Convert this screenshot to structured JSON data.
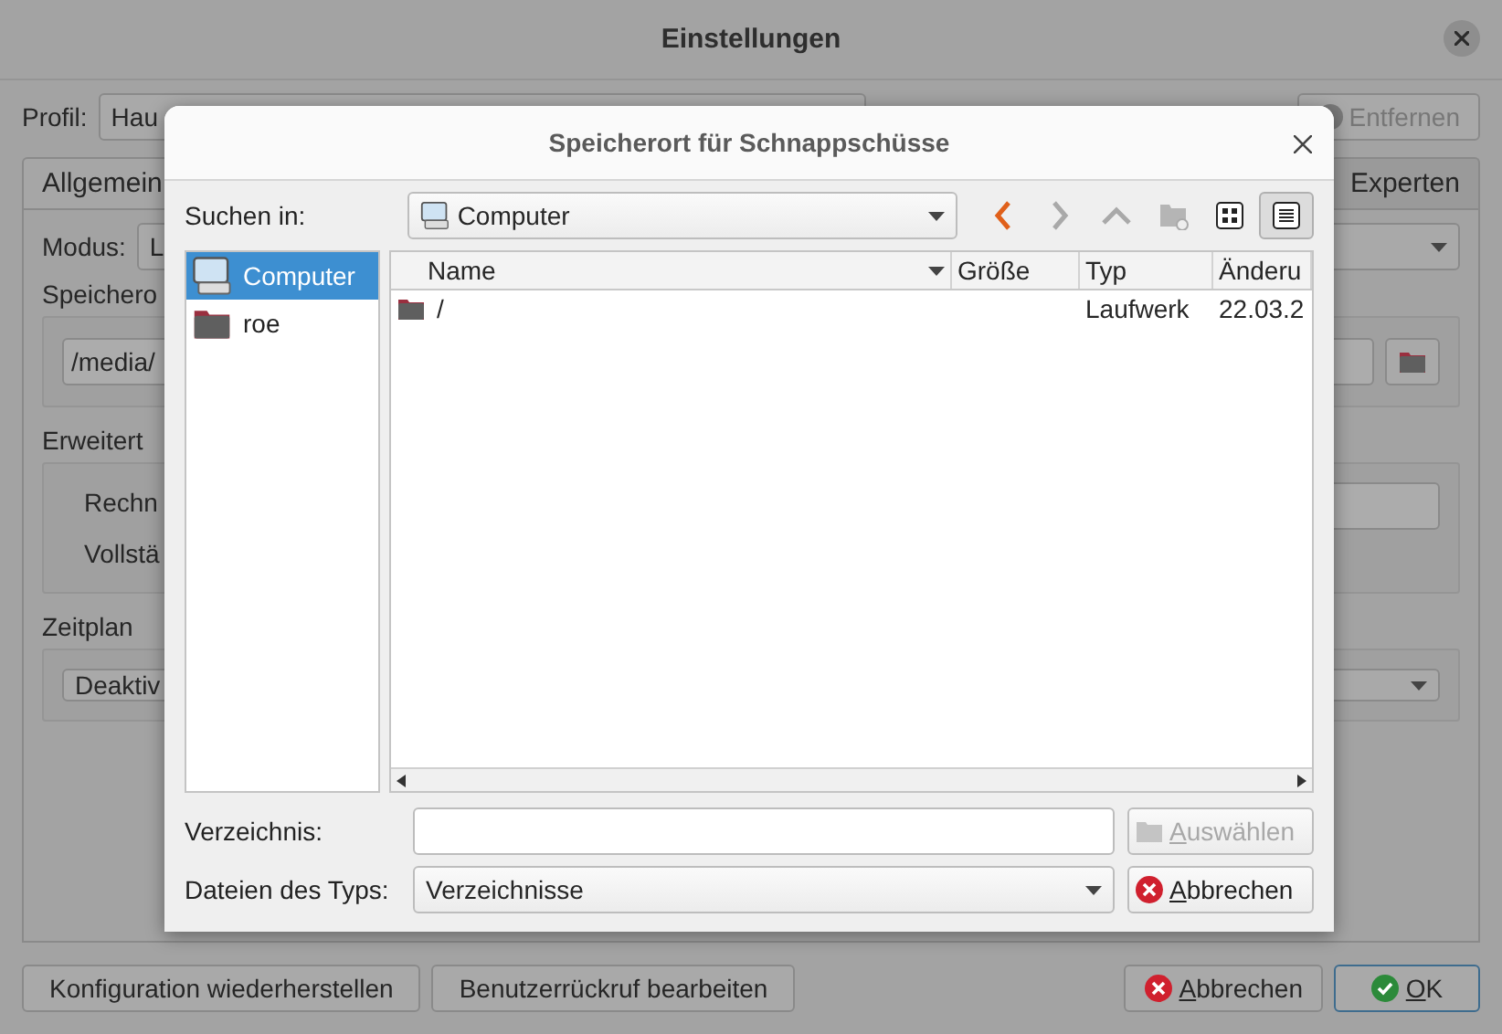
{
  "window": {
    "title": "Einstellungen"
  },
  "profile": {
    "label": "Profil:",
    "value": "Hau",
    "remove_button": {
      "label": "Entfernen",
      "disabled": true
    }
  },
  "tabs": [
    {
      "label": "Allgemein",
      "selected": true
    },
    {
      "label": "Experten",
      "selected": false
    }
  ],
  "general": {
    "mode_label": "Modus:",
    "mode_value": "L",
    "location_label": "Speichero",
    "location_value": "/media/",
    "advanced_label": "Erweitert",
    "advanced_rows": [
      "Rechn",
      "Vollstä"
    ],
    "schedule_label": "Zeitplan",
    "schedule_value": "Deaktiv"
  },
  "footer": {
    "left_buttons": [
      "Konfiguration wiederherstellen",
      "Benutzerrückruf bearbeiten"
    ],
    "cancel": "Abbrechen",
    "ok": "OK"
  },
  "dialog": {
    "title": "Speicherort für Schnappschüsse",
    "look_in_label": "Suchen in:",
    "look_in_value": "Computer",
    "toolbar": [
      {
        "kind": "back",
        "disabled": false
      },
      {
        "kind": "forward",
        "disabled": true
      },
      {
        "kind": "up",
        "disabled": true
      },
      {
        "kind": "new-folder",
        "disabled": true
      },
      {
        "kind": "icon-view",
        "selected": false
      },
      {
        "kind": "list-view",
        "selected": true
      }
    ],
    "places": [
      {
        "label": "Computer",
        "kind": "computer",
        "selected": true
      },
      {
        "label": "roe",
        "kind": "folder",
        "selected": false
      }
    ],
    "columns": [
      "Name",
      "Größe",
      "Typ",
      "Änderu"
    ],
    "rows": [
      {
        "name": "/",
        "type": "Laufwerk",
        "modified": "22.03.2"
      }
    ],
    "directory_label": "Verzeichnis:",
    "choose_button": {
      "label": "Auswählen",
      "disabled": true
    },
    "filetype_label": "Dateien des Typs:",
    "filetype_value": "Verzeichnisse",
    "cancel_button": "Abbrechen"
  }
}
